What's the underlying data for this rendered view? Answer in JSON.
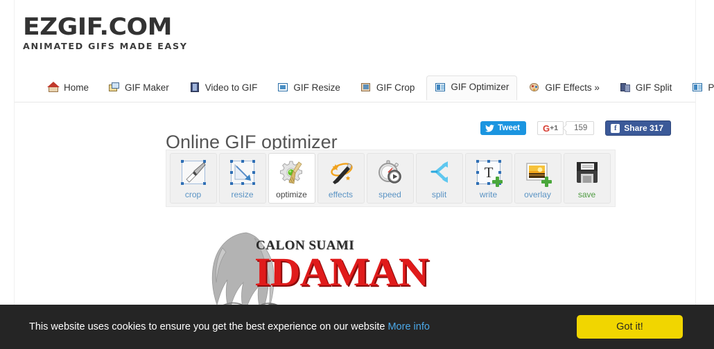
{
  "site": {
    "logo_main": "EZGIF.COM",
    "logo_sub": "ANIMATED GIFS MADE EASY"
  },
  "nav": {
    "items": [
      {
        "label": "Home",
        "icon": "home-icon",
        "icon_class": "ico-home",
        "active": false
      },
      {
        "label": "GIF Maker",
        "icon": "gif-maker-icon",
        "icon_class": "ico-maker",
        "active": false
      },
      {
        "label": "Video to GIF",
        "icon": "film-strip-icon",
        "icon_class": "ico-film",
        "active": false
      },
      {
        "label": "GIF Resize",
        "icon": "resize-icon",
        "icon_class": "ico-resize",
        "active": false
      },
      {
        "label": "GIF Crop",
        "icon": "crop-icon",
        "icon_class": "ico-crop",
        "active": false
      },
      {
        "label": "GIF Optimizer",
        "icon": "optimizer-icon",
        "icon_class": "ico-opt",
        "active": true
      },
      {
        "label": "GIF Effects »",
        "icon": "palette-icon",
        "icon_class": "ico-effects",
        "active": false
      },
      {
        "label": "GIF Split",
        "icon": "split-icon",
        "icon_class": "ico-split",
        "active": false
      },
      {
        "label": "PNG Optimizer",
        "icon": "png-optimizer-icon",
        "icon_class": "ico-png",
        "active": false
      }
    ]
  },
  "main": {
    "page_title": "Online GIF optimizer"
  },
  "social": {
    "tweet_label": "Tweet",
    "gplus_label": "G+1",
    "gplus_g": "G",
    "gplus_plus_one": "+1",
    "gplus_count": "159",
    "facebook_label": "Share 317",
    "facebook_mark": "f",
    "colors": {
      "twitter_blue": "#1b95e0",
      "facebook_blue": "#3b5998",
      "google_red": "#d73d32"
    }
  },
  "toolbar": {
    "tools": [
      {
        "label": "crop",
        "icon": "crop-tool-icon",
        "active": false,
        "green": false
      },
      {
        "label": "resize",
        "icon": "resize-tool-icon",
        "active": false,
        "green": false
      },
      {
        "label": "optimize",
        "icon": "optimize-tool-icon",
        "active": true,
        "green": false
      },
      {
        "label": "effects",
        "icon": "effects-tool-icon",
        "active": false,
        "green": false
      },
      {
        "label": "speed",
        "icon": "speed-tool-icon",
        "active": false,
        "green": false
      },
      {
        "label": "split",
        "icon": "split-tool-icon",
        "active": false,
        "green": false
      },
      {
        "label": "write",
        "icon": "write-tool-icon",
        "active": false,
        "green": false
      },
      {
        "label": "overlay",
        "icon": "overlay-tool-icon",
        "active": false,
        "green": false
      },
      {
        "label": "save",
        "icon": "save-tool-icon",
        "active": false,
        "green": true
      }
    ]
  },
  "preview": {
    "caption": "CALON SUAMI",
    "title": "IDAMAN",
    "title_color": "#e01b1b"
  },
  "cookie": {
    "message": "This website uses cookies to ensure you get the best experience on our website",
    "link_label": "More info",
    "button_label": "Got it!",
    "button_color": "#f1d600",
    "background": "#252525"
  }
}
